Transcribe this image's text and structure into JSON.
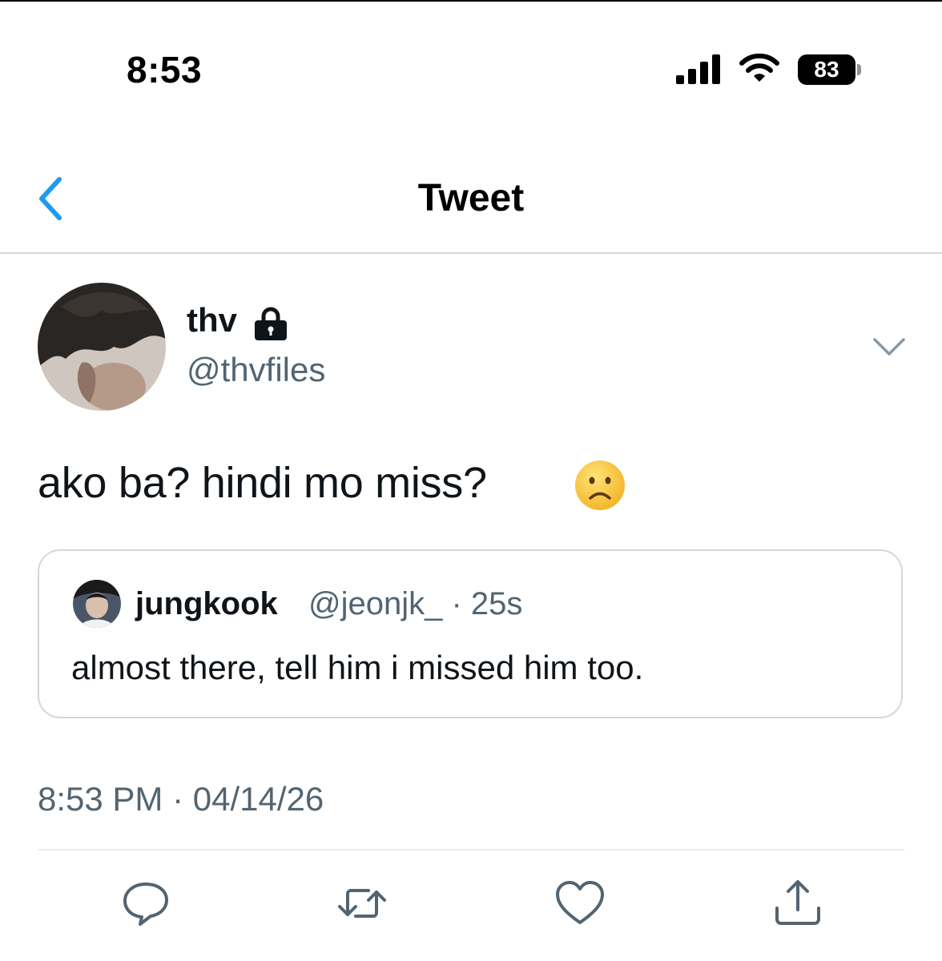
{
  "status_bar": {
    "time": "8:53",
    "battery_percent": "83"
  },
  "nav": {
    "title": "Tweet",
    "back_icon": "chevron-left-icon"
  },
  "tweet": {
    "author": {
      "name": "thv",
      "handle": "@thvfiles",
      "protected_icon": "lock-icon"
    },
    "text": "ako ba? hindi mo miss?",
    "emoji_icon": "frowning-face-emoji",
    "quoted": {
      "name": "jungkook",
      "handle_time": "@jeonjk_ · 25s",
      "text": "almost there, tell him i missed him too."
    },
    "timestamp": "8:53 PM · 04/14/26"
  },
  "actions": [
    "reply-icon",
    "retweet-icon",
    "like-icon",
    "share-icon"
  ],
  "colors": {
    "accent": "#1d9bf0",
    "secondary_text": "#536471",
    "border": "#cfd9de"
  }
}
